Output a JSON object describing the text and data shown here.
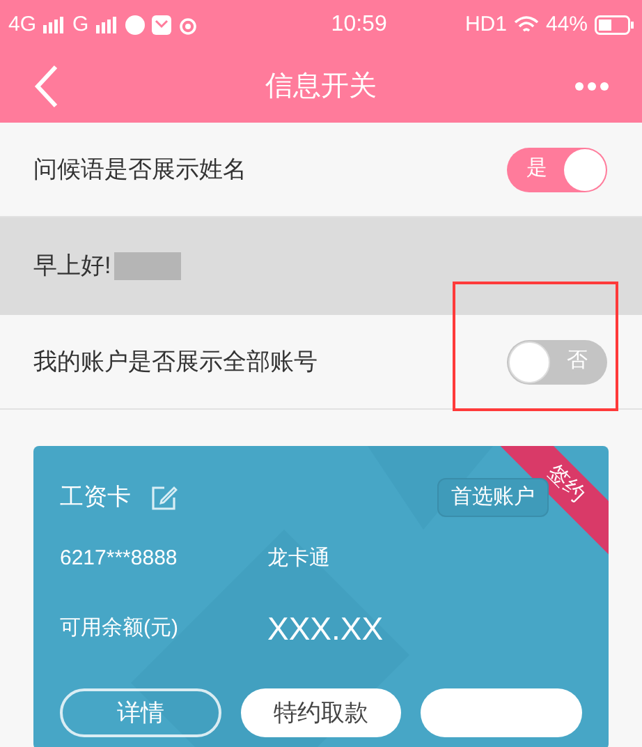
{
  "status_bar": {
    "network_1": "4G",
    "network_2": "G",
    "time": "10:59",
    "hd": "HD1",
    "battery": "44%"
  },
  "nav": {
    "title": "信息开关"
  },
  "settings": [
    {
      "kind": "toggle",
      "label": "问候语是否展示姓名",
      "on": true,
      "on_text": "是"
    },
    {
      "kind": "greeting",
      "text": "早上好!"
    },
    {
      "kind": "toggle",
      "label": "我的账户是否展示全部账号",
      "on": false,
      "off_text": "否"
    }
  ],
  "card": {
    "name": "工资卡",
    "preferred": "首选账户",
    "ribbon": "签约",
    "number": "6217***8888",
    "type": "龙卡通",
    "balance_label": "可用余额(元)",
    "balance": "XXX.XX",
    "buttons": [
      {
        "kind": "outline",
        "label": "详情"
      },
      {
        "kind": "solid",
        "label": "特约取款"
      },
      {
        "kind": "solid"
      }
    ]
  }
}
